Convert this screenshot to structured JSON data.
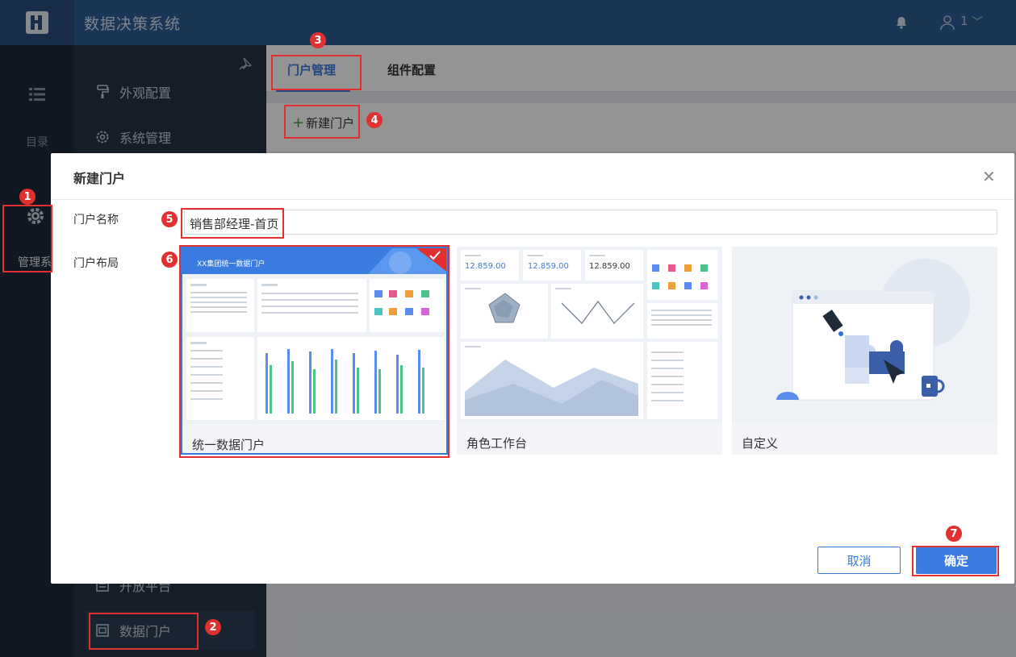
{
  "app": {
    "title": "数据决策系统",
    "user_label": "1"
  },
  "rail": {
    "directory_label": "目录",
    "admin_label": "管理系"
  },
  "sidebar": {
    "items": [
      {
        "label": "外观配置"
      },
      {
        "label": "系统管理"
      },
      {
        "label": "开放平台"
      },
      {
        "label": "数据门户"
      }
    ]
  },
  "main": {
    "tabs": [
      {
        "label": "门户管理"
      },
      {
        "label": "组件配置"
      }
    ],
    "new_portal_label": "新建门户"
  },
  "dialog": {
    "title": "新建门户",
    "name_label": "门户名称",
    "name_value": "销售部经理-首页",
    "layout_label": "门户布局",
    "layouts": [
      {
        "label": "统一数据门户",
        "banner": "XX集团统一数据门户",
        "selected": true
      },
      {
        "label": "角色工作台",
        "kpis": [
          "12.859.00",
          "12.859.00",
          "12.859.00"
        ]
      },
      {
        "label": "自定义"
      }
    ],
    "cancel_label": "取消",
    "ok_label": "确定"
  },
  "annotations": [
    "1",
    "2",
    "3",
    "4",
    "5",
    "6",
    "7"
  ],
  "colors": {
    "accent": "#3a7be0",
    "annotation": "#e03030",
    "topbar": "#2c5d92"
  }
}
